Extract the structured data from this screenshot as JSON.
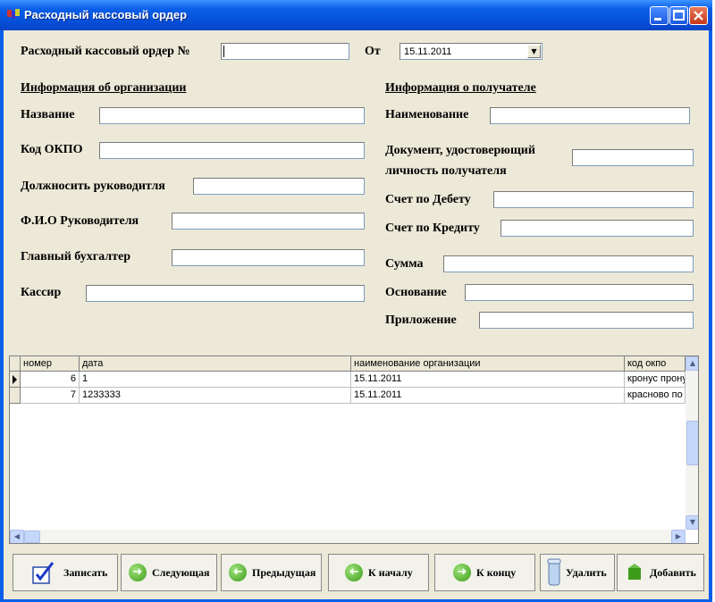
{
  "window": {
    "title": "Расходный кассовый ордер"
  },
  "form": {
    "order_label": "Расходный кассовый ордер №",
    "order_value": "",
    "date_label": "От",
    "date_value": "15.11.2011"
  },
  "org": {
    "header": "Информация об организации",
    "name_label": "Название",
    "okpo_label": "Код ОКПО",
    "position_label": "Должносить руководитля",
    "head_label": "Ф.И.О Руководителя",
    "accountant_label": "Главный бухгалтер",
    "cashier_label": "Кассир"
  },
  "recipient": {
    "header": "Информация о получателе",
    "name_label": "Наименование",
    "doc_label_line1": "Документ, удостоверющий",
    "doc_label_line2": "личность получателя",
    "debit_label": "Счет по Дебету",
    "credit_label": "Счет по Кредиту",
    "sum_label": "Сумма",
    "basis_label": "Основание",
    "attachment_label": "Приложение"
  },
  "grid": {
    "columns": [
      "номер",
      "дата",
      "наименование организации",
      "код окпо"
    ],
    "rows": [
      [
        "6",
        "1",
        "15.11.2011",
        "кронус прону"
      ],
      [
        "7",
        "1233333",
        "15.11.2011",
        "красново по"
      ]
    ]
  },
  "buttons": {
    "save": "Записать",
    "next": "Следующая",
    "prev": "Предыдущая",
    "first": "К началу",
    "last": "К концу",
    "delete": "Удалить",
    "add": "Добавить"
  },
  "colors": {
    "title_bar": "#0a5ee8",
    "client_bg": "#ece9d8",
    "icon_green": "#3c9c1a"
  }
}
